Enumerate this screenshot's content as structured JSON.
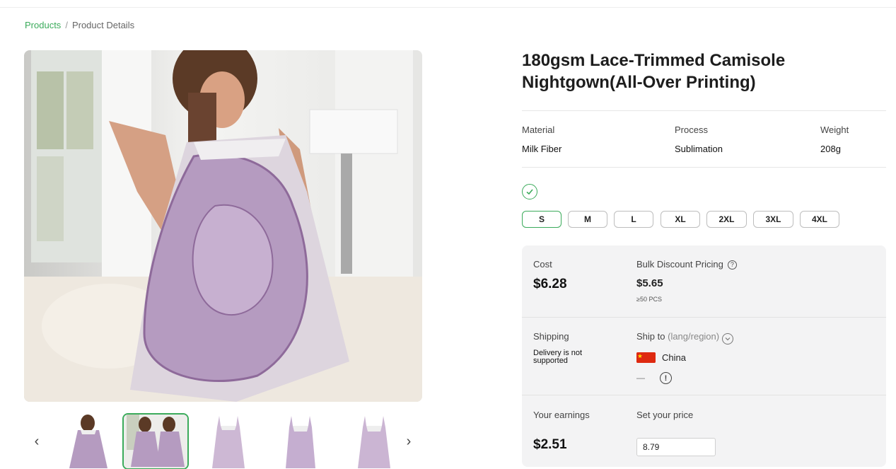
{
  "breadcrumb": {
    "link": "Products",
    "separator": "/",
    "current": "Product Details"
  },
  "gallery": {
    "main_image_icon": "photo-woman-in-lilac-floral-camisole-nightgown",
    "prev_icon": "chevron-left-icon",
    "next_icon": "chevron-right-icon",
    "prev_glyph": "‹",
    "next_glyph": "›",
    "active_thumb": 1,
    "thumb_count": 5
  },
  "product": {
    "title": "180gsm Lace-Trimmed Camisole Nightgown(All-Over Printing)",
    "specs": {
      "material_label": "Material",
      "material_value": "Milk Fiber",
      "process_label": "Process",
      "process_value": "Sublimation",
      "weight_label": "Weight",
      "weight_value": "208g"
    },
    "sizes": [
      "S",
      "M",
      "L",
      "XL",
      "2XL",
      "3XL",
      "4XL"
    ],
    "selected_size": "S"
  },
  "pricing": {
    "cost_label": "Cost",
    "cost_value": "$6.28",
    "bulk_label": "Bulk Discount Pricing",
    "bulk_help_glyph": "?",
    "bulk_value": "$5.65",
    "bulk_note": "≥50 PCS"
  },
  "shipping": {
    "label": "Shipping",
    "note": "Delivery is not supported",
    "ship_to_label": "Ship to",
    "ship_to_hint": "(lang/region)",
    "country": "China",
    "dash": "—",
    "warn_glyph": "!"
  },
  "earnings": {
    "label": "Your earnings",
    "value": "$2.51",
    "set_price_label": "Set your price",
    "set_price_value": "8.79"
  },
  "colors": {
    "accent": "#3bab5b",
    "panel_bg": "#f3f3f4",
    "flag_red": "#de2910",
    "flag_yellow": "#ffde00"
  }
}
